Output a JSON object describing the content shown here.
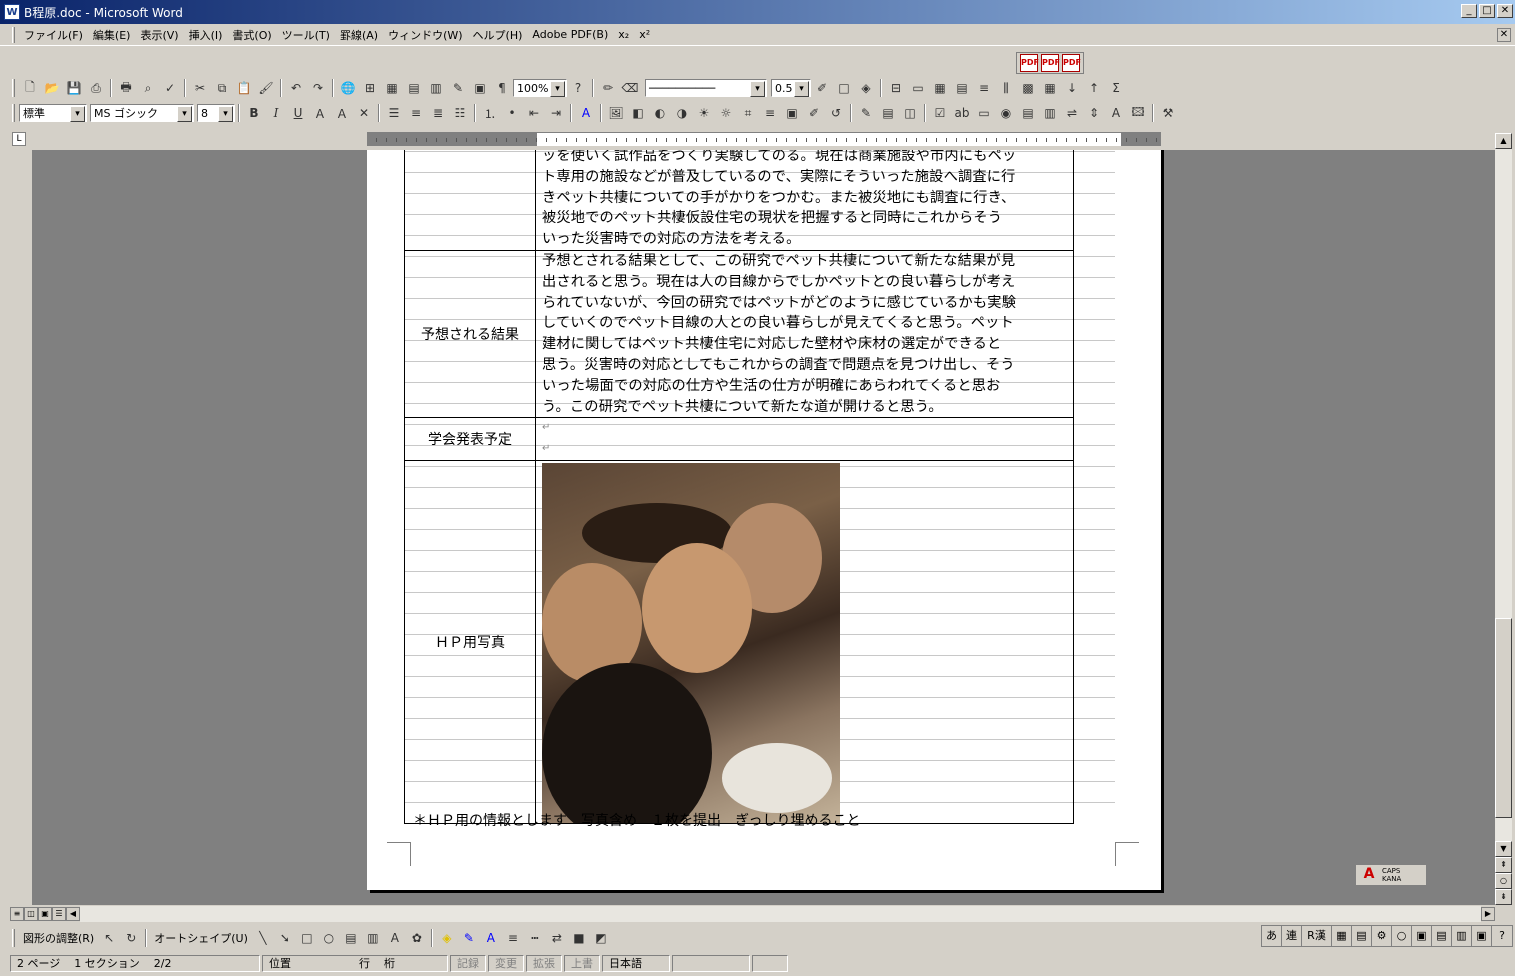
{
  "window": {
    "title": "B程原.doc - Microsoft Word",
    "app_icon": "W"
  },
  "menu": [
    "ファイル(F)",
    "編集(E)",
    "表示(V)",
    "挿入(I)",
    "書式(O)",
    "ツール(T)",
    "罫線(A)",
    "ウィンドウ(W)",
    "ヘルプ(H)",
    "Adobe PDF(B)",
    "x₂",
    "x²"
  ],
  "toolbar": {
    "zoom": "100%",
    "style": "標準",
    "font": "MS ゴシック",
    "font_size": "8",
    "line_weight": "0.5",
    "bold": "B",
    "italic": "I",
    "underline": "U"
  },
  "document": {
    "rows": [
      {
        "label": "",
        "lines": [
          "ッを使いく試作品をつくり実験してのる。現在は商業施設や市内にもペッ",
          "ト専用の施設などが普及しているので、実際にそういった施設へ調査に行",
          "きペット共棲についての手がかりをつかむ。また被災地にも調査に行き、",
          "被災地でのペット共棲仮設住宅の現状を把握すると同時にこれからそう",
          "いった災害時での対応の方法を考える。"
        ]
      },
      {
        "label": "予想される結果",
        "lines": [
          "予想とされる結果として、この研究でペット共棲について新たな結果が見",
          "出されると思う。現在は人の目線からでしかペットとの良い暮らしが考え",
          "られていないが、今回の研究ではペットがどのように感じているかも実験",
          "していくのでペット目線の人との良い暮らしが見えてくると思う。ペット",
          "建材に関してはペット共棲住宅に対応した壁材や床材の選定ができると",
          "思う。災害時の対応としてもこれからの調査で問題点を見つけ出し、そう",
          "いった場面での対応の仕方や生活の仕方が明確にあらわれてくると思お",
          "う。この研究でペット共棲について新たな道が開けると思う。"
        ]
      },
      {
        "label": "学会発表予定",
        "lines": [
          "",
          ""
        ]
      },
      {
        "label": "ＨＰ用写真",
        "lines": []
      }
    ],
    "footer_note": "＊ＨＰ用の情報とします　写真含め　１枚を提出　ぎっしり埋めること"
  },
  "ruler_labels": [
    "2",
    "2",
    "4",
    "6",
    "8",
    "10",
    "12",
    "14",
    "16",
    "18",
    "20",
    "22",
    "24",
    "26",
    "28",
    "30",
    "32",
    "34",
    "36",
    "38",
    "40",
    "42",
    "44",
    "46"
  ],
  "ime_widget": {
    "caps": "CAPS",
    "kana": "KANA"
  },
  "drawbar": {
    "draw_label": "図形の調整(R)",
    "autoshape_label": "オートシェイプ(U)"
  },
  "ime_keys": [
    "あ",
    "連",
    "R漢"
  ],
  "status": {
    "page": "2 ページ",
    "section": "1 セクション",
    "pages": "2/2",
    "position": "位置",
    "line": "行",
    "column": "桁",
    "rec": "記録",
    "trk": "変更",
    "ext": "拡張",
    "ovr": "上書",
    "lang": "日本語"
  }
}
